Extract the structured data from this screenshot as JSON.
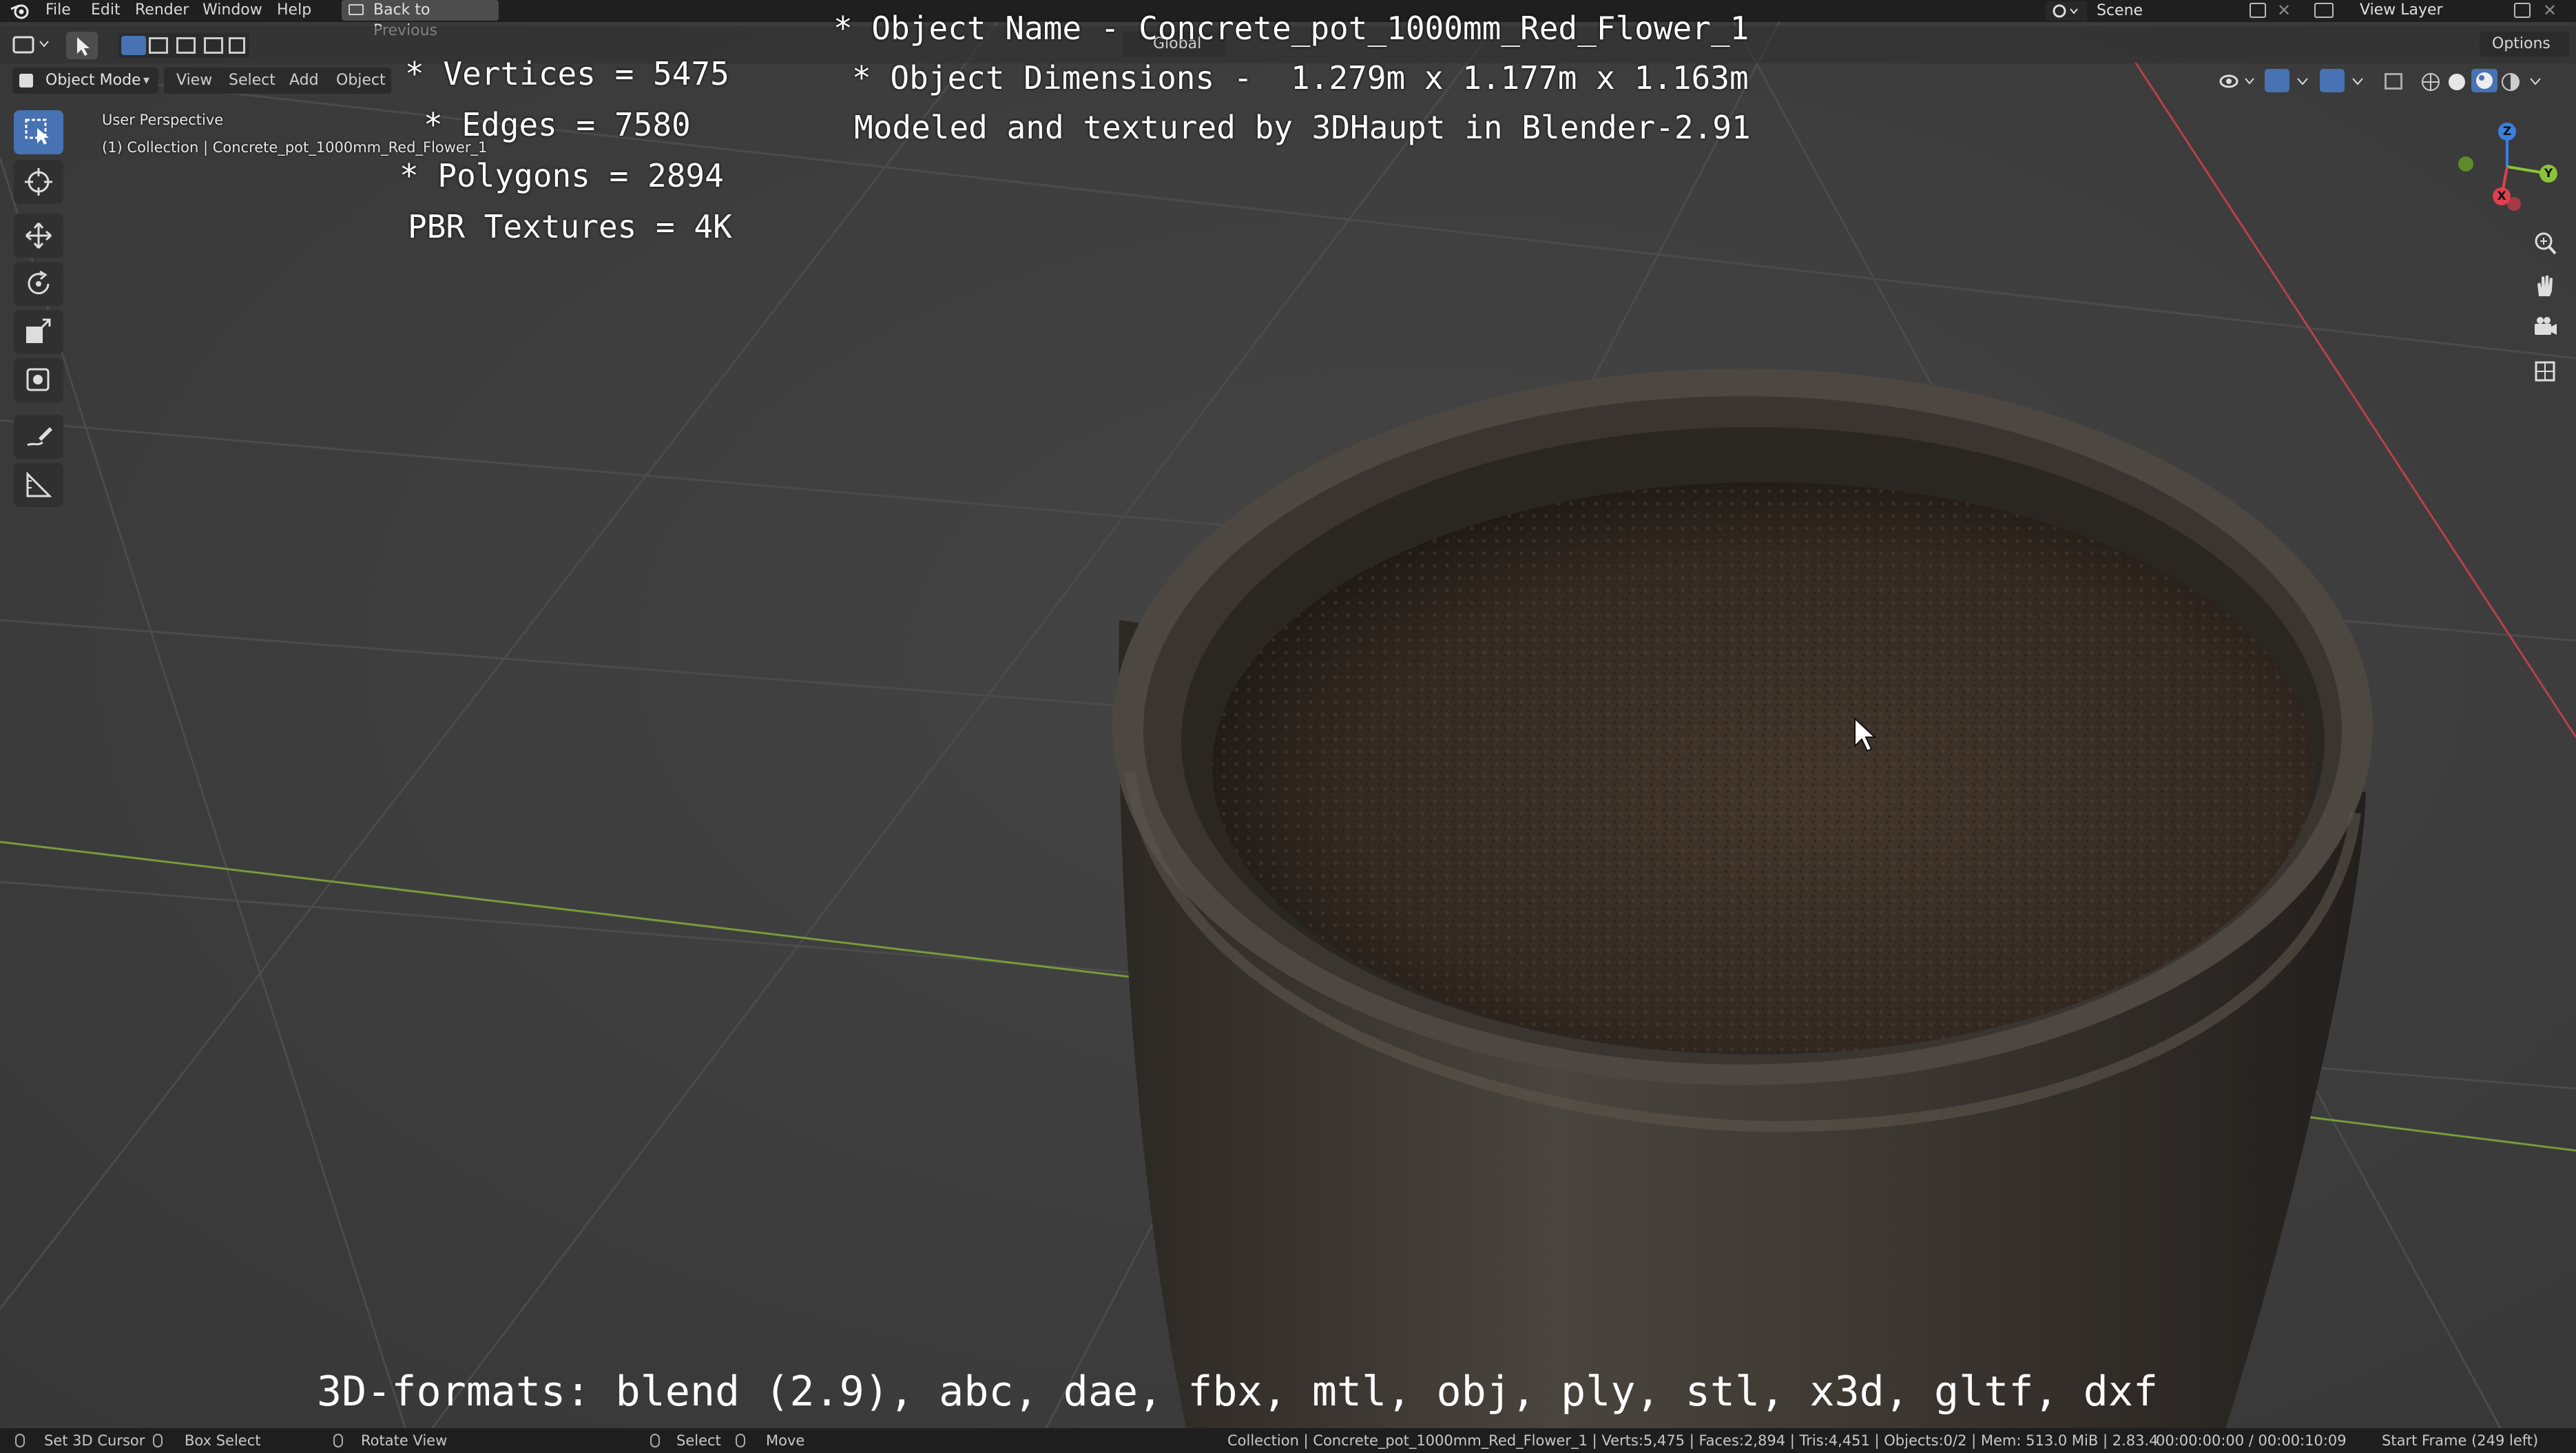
{
  "app": {
    "menu": [
      "File",
      "Edit",
      "Render",
      "Window",
      "Help"
    ],
    "back_button": "Back to Previous",
    "scene_label": "Scene",
    "view_layer_label": "View Layer"
  },
  "header": {
    "mode": "Object Mode",
    "menus": [
      "View",
      "Select",
      "Add",
      "Object"
    ],
    "transform_orientation": "Global",
    "options_label": "Options"
  },
  "viewport": {
    "perspective_label": "User Perspective",
    "collection_label": "(1) Collection | Concrete_pot_1000mm_Red_Flower_1",
    "gizmo_axes": [
      "Z",
      "Y",
      "X"
    ]
  },
  "overlay": {
    "vertices": "* Vertices = 5475",
    "edges": "* Edges = 7580",
    "polygons": "* Polygons = 2894",
    "textures": "PBR Textures = 4K",
    "object_name": "* Object Name - Concrete_pot_1000mm_Red_Flower_1",
    "dimensions": "* Object Dimensions -  1.279m x 1.177m x 1.163m",
    "credits": "Modeled and textured by 3DHaupt in Blender-2.91",
    "formats": "3D-formats: blend (2.9), abc, dae, fbx, mtl, obj, ply, stl, x3d, gltf, dxf"
  },
  "statusbar": {
    "set_cursor": "Set 3D Cursor",
    "box_select": "Box Select",
    "rotate_view": "Rotate View",
    "select": "Select",
    "move": "Move",
    "stats": "Collection | Concrete_pot_1000mm_Red_Flower_1 | Verts:5,475 | Faces:2,894 | Tris:4,451 | Objects:0/2 | Mem: 513.0 MiB | 2.83.4",
    "timecode": "00:00:00:00 / 00:00:10:09",
    "start_frame": "Start Frame (249 left)"
  },
  "colors": {
    "accent": "#4772b3",
    "axis_x": "#e0404f",
    "axis_y": "#8ac33a",
    "axis_z": "#3b7fe0"
  },
  "icons": [
    "blender-logo-icon",
    "select-box-icon",
    "cursor-icon",
    "move-icon",
    "rotate-icon",
    "scale-icon",
    "transform-icon",
    "annotate-icon",
    "measure-icon",
    "zoom-icon",
    "hand-icon",
    "camera-icon",
    "grid-icon",
    "mouse-pointer-icon"
  ]
}
